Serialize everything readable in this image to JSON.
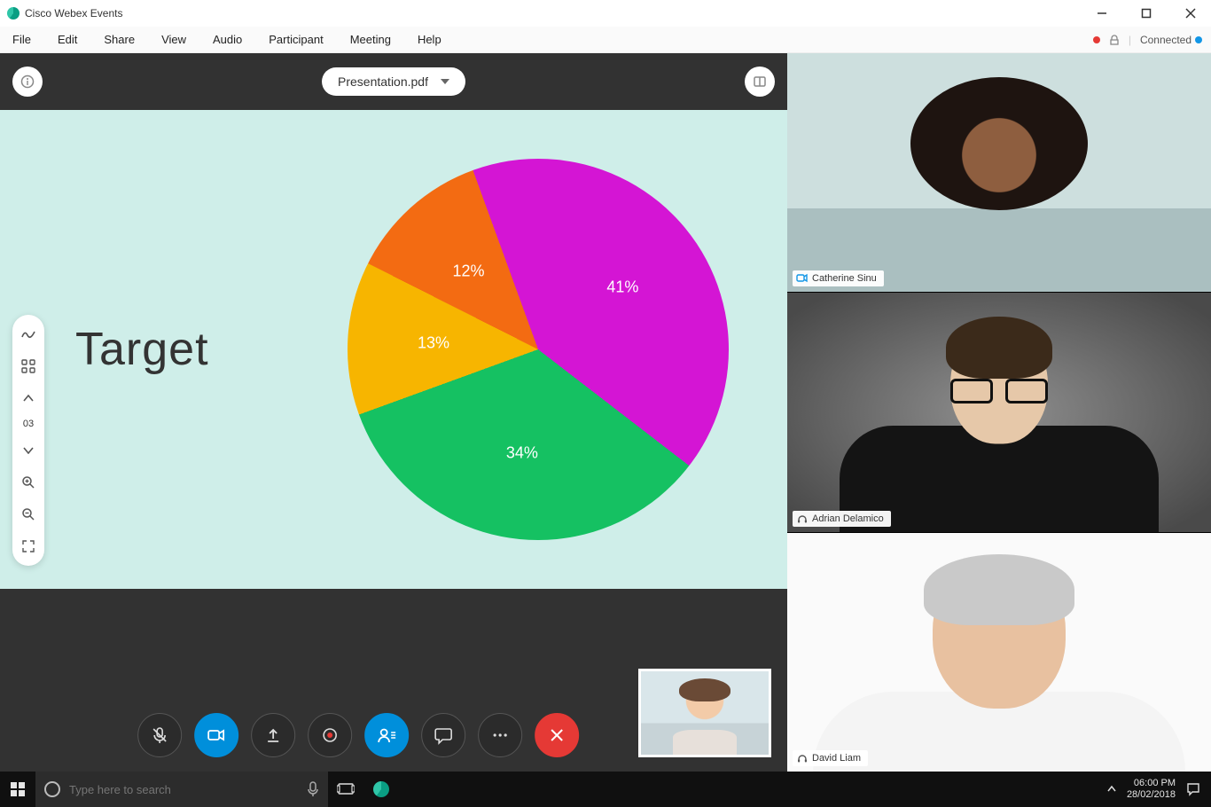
{
  "window": {
    "title": "Cisco Webex Events"
  },
  "menubar": {
    "items": [
      "File",
      "Edit",
      "Share",
      "View",
      "Audio",
      "Participant",
      "Meeting",
      "Help"
    ],
    "connected_label": "Connected"
  },
  "stage": {
    "document_name": "Presentation.pdf",
    "slide_title": "Target",
    "page_number": "03"
  },
  "chart_data": {
    "type": "pie",
    "title": "Target",
    "slices": [
      {
        "label": "41%",
        "value": 41,
        "color": "#d415d4"
      },
      {
        "label": "34%",
        "value": 34,
        "color": "#15c162"
      },
      {
        "label": "13%",
        "value": 13,
        "color": "#f7b500"
      },
      {
        "label": "12%",
        "value": 12,
        "color": "#f36b12"
      }
    ]
  },
  "controls": {
    "mute": "mute-button",
    "video": "video-button",
    "share": "share-button",
    "record": "record-button",
    "participants": "participants-button",
    "chat": "chat-button",
    "more": "more-options-button",
    "end": "end-call-button"
  },
  "participants": [
    {
      "name": "Catherine Sinu"
    },
    {
      "name": "Adrian Delamico"
    },
    {
      "name": "David Liam"
    }
  ],
  "taskbar": {
    "search_placeholder": "Type here to search",
    "time": "06:00 PM",
    "date": "28/02/2018"
  }
}
